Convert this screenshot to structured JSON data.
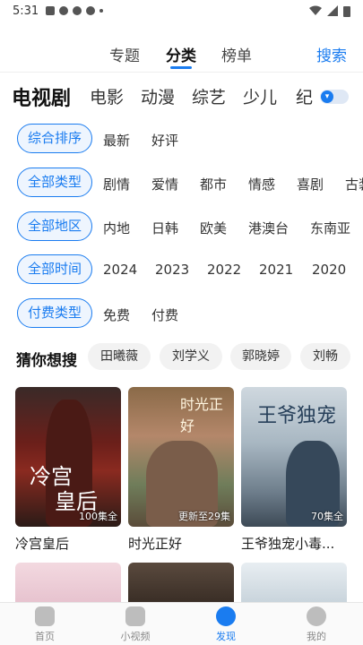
{
  "status": {
    "time": "5:31"
  },
  "topnav": {
    "tabs": [
      "专题",
      "分类",
      "榜单"
    ],
    "search": "搜索"
  },
  "categories": [
    "电视剧",
    "电影",
    "动漫",
    "综艺",
    "少儿",
    "纪"
  ],
  "filters": [
    {
      "pill": "综合排序",
      "options": [
        "最新",
        "好评"
      ]
    },
    {
      "pill": "全部类型",
      "options": [
        "剧情",
        "爱情",
        "都市",
        "情感",
        "喜剧",
        "古装"
      ]
    },
    {
      "pill": "全部地区",
      "options": [
        "内地",
        "日韩",
        "欧美",
        "港澳台",
        "东南亚"
      ]
    },
    {
      "pill": "全部时间",
      "options": [
        "2024",
        "2023",
        "2022",
        "2021",
        "2020"
      ]
    },
    {
      "pill": "付费类型",
      "options": [
        "免费",
        "付费"
      ]
    }
  ],
  "guess": {
    "label": "猜你想搜",
    "chips": [
      "田曦薇",
      "刘学义",
      "郭晓婷",
      "刘畅"
    ]
  },
  "cards": [
    {
      "title": "冷宫皇后",
      "badge": "100集全",
      "art": [
        "冷宫",
        "皇后"
      ]
    },
    {
      "title": "时光正好",
      "badge": "更新至29集",
      "art": [
        "时光正好"
      ]
    },
    {
      "title": "王爷独宠小毒...",
      "badge": "70集全",
      "art": [
        "王爷独宠"
      ]
    }
  ],
  "tabbar": [
    "首页",
    "小视频",
    "发现",
    "我的"
  ],
  "colors": {
    "accent": "#1a7cf0",
    "pill_bg": "#eef5fe",
    "chip_bg": "#f2f2f2"
  },
  "icons": {
    "home": "home-icon",
    "video": "video-icon",
    "discover": "compass-icon",
    "me": "profile-icon"
  }
}
